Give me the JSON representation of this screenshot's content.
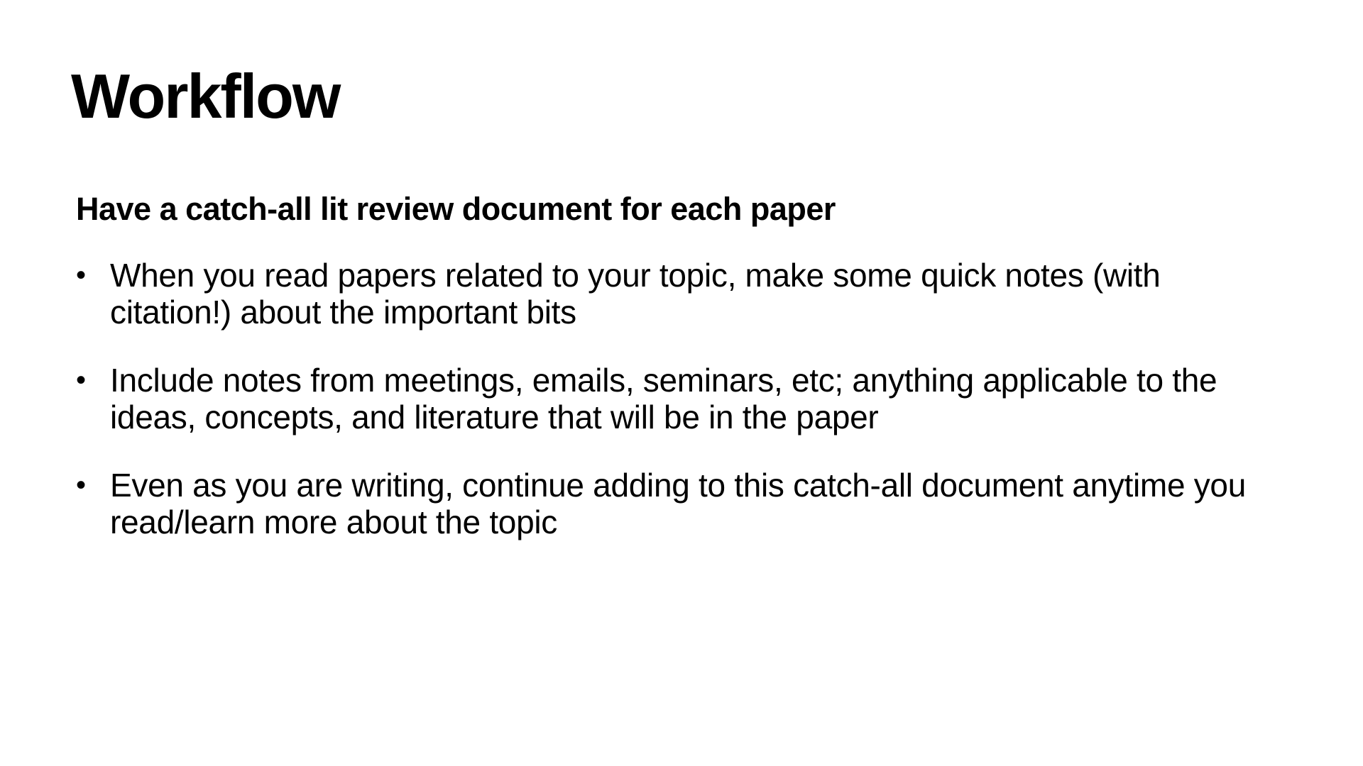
{
  "slide": {
    "title": "Workflow",
    "subheading": "Have a catch-all lit review document for each paper",
    "bullet_glyph": "•",
    "bullets": [
      {
        "text": "When you read papers related to your topic, make some quick notes (with citation!) about the important bits"
      },
      {
        "text": "Include notes from meetings, emails, seminars, etc; anything applicable to the ideas, concepts, and literature that will be in the paper"
      },
      {
        "text": "Even as you are writing, continue adding to this catch-all document anytime you read/learn more about the topic"
      }
    ]
  }
}
